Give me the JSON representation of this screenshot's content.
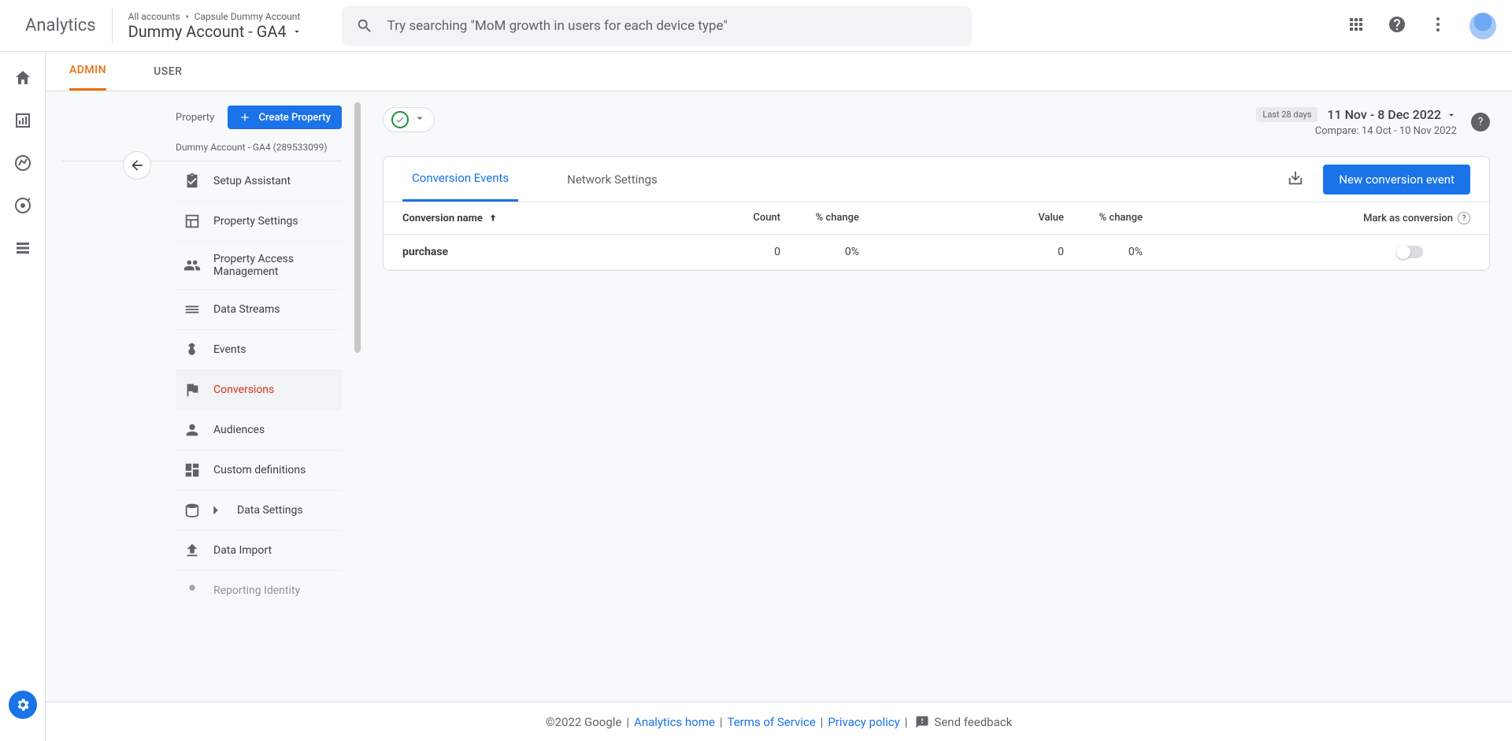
{
  "header": {
    "product": "Analytics",
    "breadcrumb_root": "All accounts",
    "breadcrumb_account": "Capsule Dummy Account",
    "account_selector": "Dummy Account - GA4",
    "search_placeholder": "Try searching \"MoM growth in users for each device type\""
  },
  "tabs": {
    "admin": "ADMIN",
    "user": "USER"
  },
  "sidebar": {
    "label": "Property",
    "create_btn": "Create Property",
    "subtitle": "Dummy Account - GA4 (289533099)",
    "items": [
      {
        "label": "Setup Assistant"
      },
      {
        "label": "Property Settings"
      },
      {
        "label": "Property Access Management"
      },
      {
        "label": "Data Streams"
      },
      {
        "label": "Events"
      },
      {
        "label": "Conversions"
      },
      {
        "label": "Audiences"
      },
      {
        "label": "Custom definitions"
      },
      {
        "label": "Data Settings"
      },
      {
        "label": "Data Import"
      },
      {
        "label": "Reporting Identity"
      }
    ]
  },
  "date": {
    "badge": "Last 28 days",
    "range": "11 Nov - 8 Dec 2022",
    "compare": "Compare: 14 Oct - 10 Nov 2022"
  },
  "card": {
    "tab1": "Conversion Events",
    "tab2": "Network Settings",
    "new_btn": "New conversion event",
    "cols": {
      "name": "Conversion name",
      "count": "Count",
      "change1": "% change",
      "value": "Value",
      "change2": "% change",
      "mark": "Mark as conversion"
    },
    "rows": [
      {
        "name": "purchase",
        "count": "0",
        "change1": "0%",
        "value": "0",
        "change2": "0%"
      }
    ]
  },
  "footer": {
    "copyright": "©2022 Google",
    "home": "Analytics home",
    "tos": "Terms of Service",
    "privacy": "Privacy policy",
    "feedback": "Send feedback"
  }
}
